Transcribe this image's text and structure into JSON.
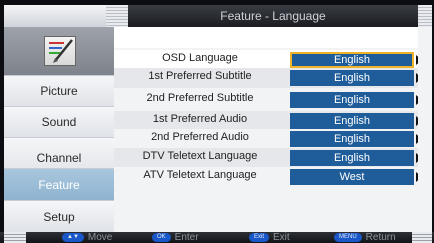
{
  "header": {
    "title": "Feature - Language"
  },
  "sidebar": {
    "items": [
      {
        "label": "Picture",
        "active": false
      },
      {
        "label": "Sound",
        "active": false
      },
      {
        "label": "Channel",
        "active": false
      },
      {
        "label": "Feature",
        "active": true
      },
      {
        "label": "Setup",
        "active": false
      }
    ]
  },
  "settings": [
    {
      "label": "OSD Language",
      "value": "English",
      "selected": true
    },
    {
      "label": "1st Preferred Subtitle",
      "value": "English",
      "selected": false
    },
    {
      "label": "2nd Preferred Subtitle",
      "value": "English",
      "selected": false
    },
    {
      "label": "1st Preferred Audio",
      "value": "English",
      "selected": false
    },
    {
      "label": "2nd Preferred Audio",
      "value": "English",
      "selected": false
    },
    {
      "label": "DTV Teletext Language",
      "value": "English",
      "selected": false
    },
    {
      "label": "ATV Teletext Language",
      "value": "West",
      "selected": false
    }
  ],
  "footer": {
    "move": {
      "key": "▲▼",
      "label": "Move"
    },
    "enter": {
      "key": "OK",
      "label": "Enter"
    },
    "exit": {
      "key": "Exit",
      "label": "Exit"
    },
    "return": {
      "key": "MENU",
      "label": "Return"
    }
  },
  "colors": {
    "value_bg": "#1f5c9a",
    "highlight": "#f0b428",
    "active_menu": "#9dbdd6"
  }
}
